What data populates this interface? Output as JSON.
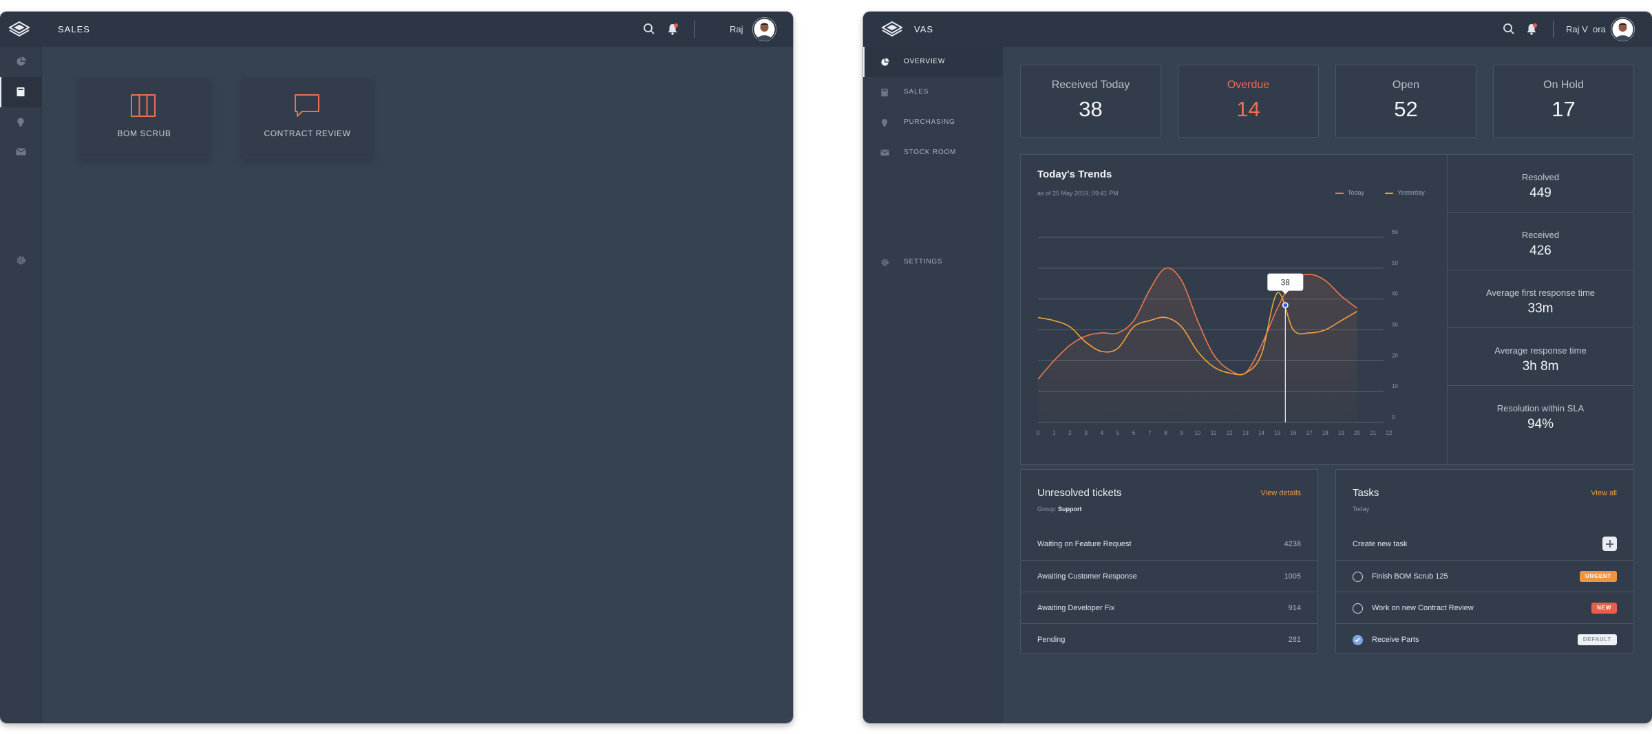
{
  "left_window": {
    "app_title": "SALES",
    "user_name": "Raj",
    "rail_icons": [
      "pie-chart-icon",
      "book-icon",
      "lightbulb-icon",
      "mail-icon",
      "settings-icon"
    ],
    "cards": [
      {
        "label": "BOM SCRUB",
        "icon": "columns-icon"
      },
      {
        "label": "CONTRACT REVIEW",
        "icon": "chat-bubble-icon"
      }
    ]
  },
  "right_window": {
    "app_title": "VAS",
    "user_name": "Raj V  ora",
    "nav": [
      {
        "label": "OVERVIEW",
        "icon": "pie-chart-icon",
        "active": true
      },
      {
        "label": "SALES",
        "icon": "book-icon"
      },
      {
        "label": "PURCHASING",
        "icon": "lightbulb-icon"
      },
      {
        "label": "STOCK ROOM",
        "icon": "mail-icon"
      },
      {
        "label": "SETTINGS",
        "icon": "settings-icon"
      }
    ],
    "kpis": [
      {
        "label": "Received Today",
        "value": "38"
      },
      {
        "label": "Overdue",
        "value": "14",
        "color": "#ee6f55"
      },
      {
        "label": "Open",
        "value": "52"
      },
      {
        "label": "On Hold",
        "value": "17"
      }
    ],
    "trends": {
      "title": "Today's Trends",
      "subtitle": "as of 25 May 2019, 09:41 PM",
      "tooltip_value": "38"
    },
    "stats": [
      {
        "label": "Resolved",
        "value": "449"
      },
      {
        "label": "Received",
        "value": "426"
      },
      {
        "label": "Average first response time",
        "value": "33m"
      },
      {
        "label": "Average response time",
        "value": "3h 8m"
      },
      {
        "label": "Resolution within SLA",
        "value": "94%"
      }
    ],
    "unresolved": {
      "title": "Unresolved tickets",
      "link": "View details",
      "group_label": "Group:",
      "group_value": "Support",
      "rows": [
        {
          "label": "Waiting on Feature Request",
          "count": "4238"
        },
        {
          "label": "Awaiting Customer Response",
          "count": "1005"
        },
        {
          "label": "Awaiting Developer Fix",
          "count": "914"
        },
        {
          "label": "Pending",
          "count": "281"
        }
      ]
    },
    "tasks": {
      "title": "Tasks",
      "link": "View all",
      "subtitle": "Today",
      "create_label": "Create new task",
      "items": [
        {
          "label": "Finish BOM Scrub 125",
          "badge": "URGENT",
          "done": false
        },
        {
          "label": "Work on new Contract Review",
          "badge": "NEW",
          "done": false
        },
        {
          "label": "Receive Parts",
          "badge": "DEFAULT",
          "done": true
        }
      ]
    }
  },
  "colors": {
    "background": "#364152",
    "topbar": "#2d3644",
    "accent_orange": "#f09a46",
    "today_series": "#ee7a4f",
    "yesterday_series": "#f0a33f",
    "overdue": "#ee6f55"
  },
  "chart_data": {
    "type": "line",
    "title": "Today's Trends",
    "subtitle": "as of 25 May 2019, 09:41 PM",
    "x": [
      0,
      1,
      2,
      3,
      4,
      5,
      6,
      7,
      8,
      9,
      10,
      11,
      12,
      13,
      14,
      15,
      16,
      17,
      18,
      19,
      20,
      21,
      22
    ],
    "x_ticks": [
      "0",
      "1",
      "2",
      "3",
      "4",
      "5",
      "6",
      "7",
      "8",
      "9",
      "10",
      "11",
      "12",
      "13",
      "14",
      "15",
      "16",
      "17",
      "18",
      "19",
      "20",
      "21",
      "22"
    ],
    "y_ticks": [
      "0",
      "10",
      "20",
      "30",
      "40",
      "50",
      "60"
    ],
    "ylim": [
      0,
      60
    ],
    "xlim": [
      0,
      22
    ],
    "grid": true,
    "legend_position": "top-right",
    "series": [
      {
        "name": "Today",
        "color": "#ee7a4f",
        "values": [
          14,
          20,
          25,
          28,
          29,
          29,
          33,
          43,
          50,
          46,
          33,
          22,
          17,
          16,
          25,
          37,
          46,
          48,
          46,
          41,
          37
        ]
      },
      {
        "name": "Yesterday",
        "color": "#f0a33f",
        "values": [
          34,
          33,
          31,
          26,
          23,
          24,
          31,
          33,
          34,
          31,
          23,
          18,
          16,
          16,
          22,
          42,
          30,
          29,
          30,
          33,
          36
        ]
      }
    ],
    "tooltip": {
      "x": 15.5,
      "value": 38
    }
  }
}
